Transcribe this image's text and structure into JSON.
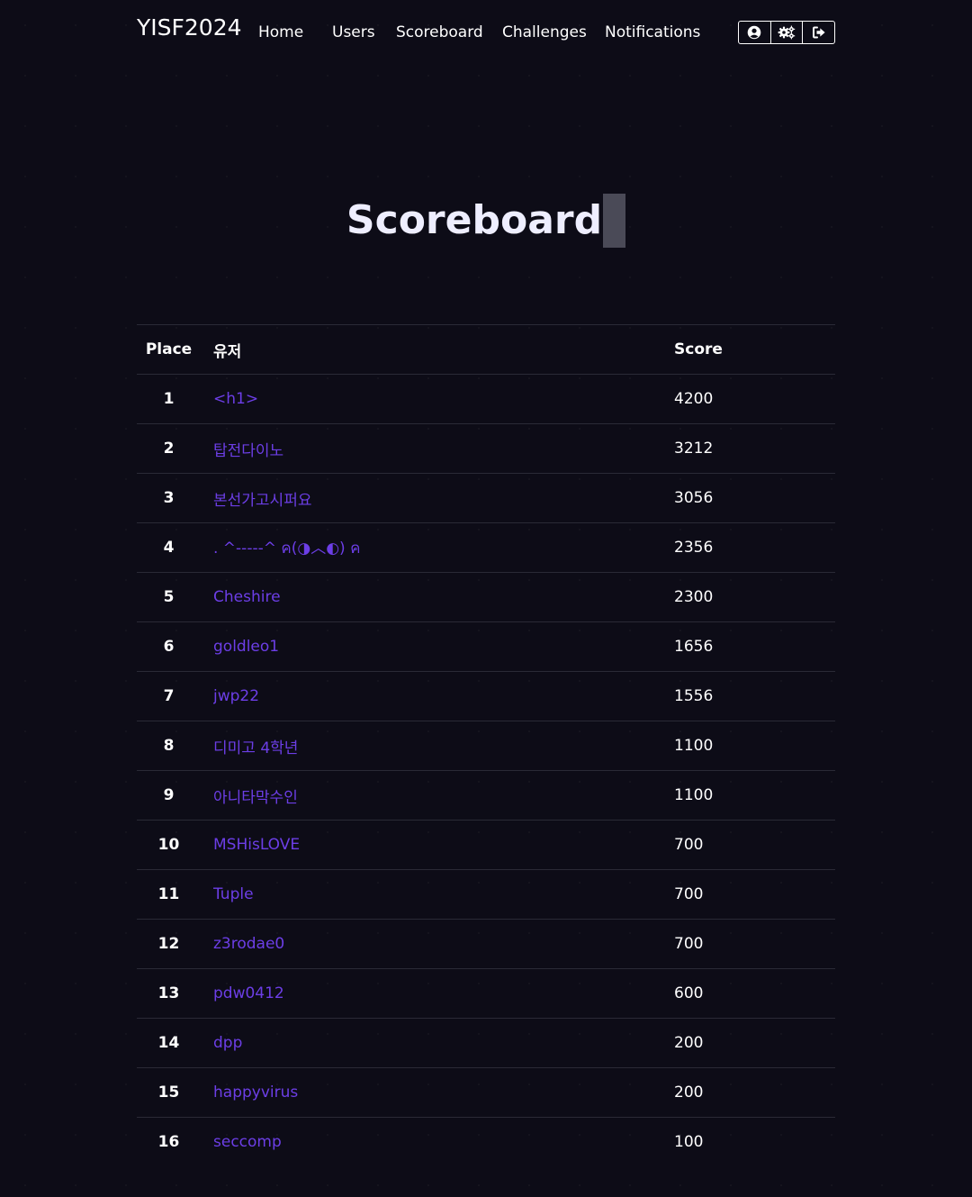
{
  "nav": {
    "brand": "YISF2024",
    "links": [
      "Home",
      "Users",
      "Scoreboard",
      "Challenges",
      "Notifications"
    ],
    "icons": [
      "user-circle-icon",
      "gears-icon",
      "sign-out-icon"
    ]
  },
  "page": {
    "title": "Scoreboard"
  },
  "table": {
    "headers": [
      "Place",
      "유저",
      "Score"
    ],
    "rows": [
      {
        "place": "1",
        "user": "<h1>",
        "score": "4200"
      },
      {
        "place": "2",
        "user": "탑전다이노",
        "score": "3212"
      },
      {
        "place": "3",
        "user": "본선가고시퍼요",
        "score": "3056"
      },
      {
        "place": "4",
        "user": ". ^-----^ ค(◑︿◐) ค",
        "score": "2356"
      },
      {
        "place": "5",
        "user": "Cheshire",
        "score": "2300"
      },
      {
        "place": "6",
        "user": "goldleo1",
        "score": "1656"
      },
      {
        "place": "7",
        "user": "jwp22",
        "score": "1556"
      },
      {
        "place": "8",
        "user": "디미고 4학년",
        "score": "1100"
      },
      {
        "place": "9",
        "user": "아니타막수인",
        "score": "1100"
      },
      {
        "place": "10",
        "user": "MSHisLOVE",
        "score": "700"
      },
      {
        "place": "11",
        "user": "Tuple",
        "score": "700"
      },
      {
        "place": "12",
        "user": "z3rodae0",
        "score": "700"
      },
      {
        "place": "13",
        "user": "pdw0412",
        "score": "600"
      },
      {
        "place": "14",
        "user": "dpp",
        "score": "200"
      },
      {
        "place": "15",
        "user": "happyvirus",
        "score": "200"
      },
      {
        "place": "16",
        "user": "seccomp",
        "score": "100"
      }
    ]
  },
  "colors": {
    "background": "#0d0c17",
    "link": "#6c3ee6",
    "divider": "#2a2a36"
  }
}
